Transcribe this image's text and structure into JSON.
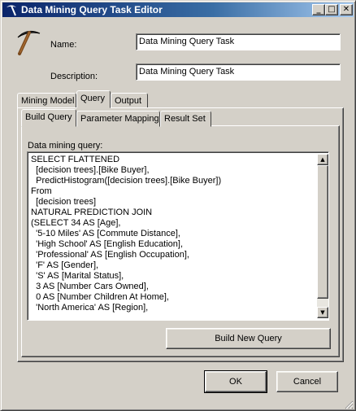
{
  "window": {
    "title": "Data Mining Query Task Editor",
    "icon": "pickaxe-icon",
    "controls": {
      "minimize": "_",
      "maximize": "□",
      "close": "✕"
    }
  },
  "task_icon": "pickaxe-icon",
  "form": {
    "name_label": "Name:",
    "name_value": "Data Mining Query Task",
    "description_label": "Description:",
    "description_value": "Data Mining Query Task"
  },
  "outer_tabs": [
    {
      "label": "Mining Model",
      "active": false
    },
    {
      "label": "Query",
      "active": true
    },
    {
      "label": "Output",
      "active": false
    }
  ],
  "inner_tabs": [
    {
      "label": "Build Query",
      "active": true
    },
    {
      "label": "Parameter Mapping",
      "active": false
    },
    {
      "label": "Result Set",
      "active": false
    }
  ],
  "query": {
    "label": "Data mining query:",
    "text": "SELECT FLATTENED\n  [decision trees].[Bike Buyer],\n  PredictHistogram([decision trees].[Bike Buyer])\nFrom\n  [decision trees]\nNATURAL PREDICTION JOIN\n(SELECT 34 AS [Age],\n  '5-10 Miles' AS [Commute Distance],\n  'High School' AS [English Education],\n  'Professional' AS [English Occupation],\n  'F' AS [Gender],\n  'S' AS [Marital Status],\n  3 AS [Number Cars Owned],\n  0 AS [Number Children At Home],\n  'North America' AS [Region],",
    "scroll_up": "▲",
    "scroll_down": "▼"
  },
  "buttons": {
    "build_new_query": "Build New Query",
    "ok": "OK",
    "cancel": "Cancel"
  },
  "colors": {
    "dialog_bg": "#d4d0c8",
    "titlebar_start": "#0a246a",
    "titlebar_end": "#a6caf0"
  }
}
